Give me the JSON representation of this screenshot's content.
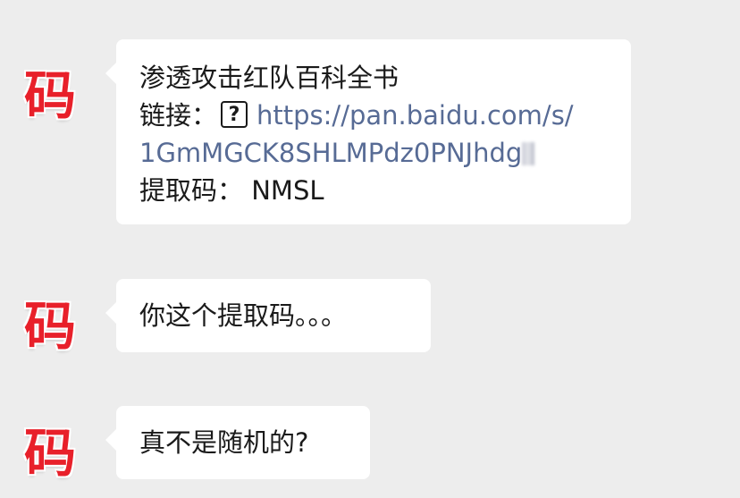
{
  "messages": [
    {
      "avatar": "码",
      "title": "渗透攻击红队百科全书",
      "link_label": "链接：",
      "link_icon": "?",
      "link_url_1": "https://pan.baidu.com/s/",
      "link_url_2": "1GmMGCK8SHLMPdz0PNJhdg",
      "code_label": "提取码：",
      "code_value": "NMSL"
    },
    {
      "avatar": "码",
      "text": "你这个提取码。。。"
    },
    {
      "avatar": "码",
      "text": "真不是随机的?"
    }
  ],
  "colors": {
    "background": "#ededed",
    "bubble": "#ffffff",
    "link": "#576b95",
    "avatar": "#e8202a"
  }
}
